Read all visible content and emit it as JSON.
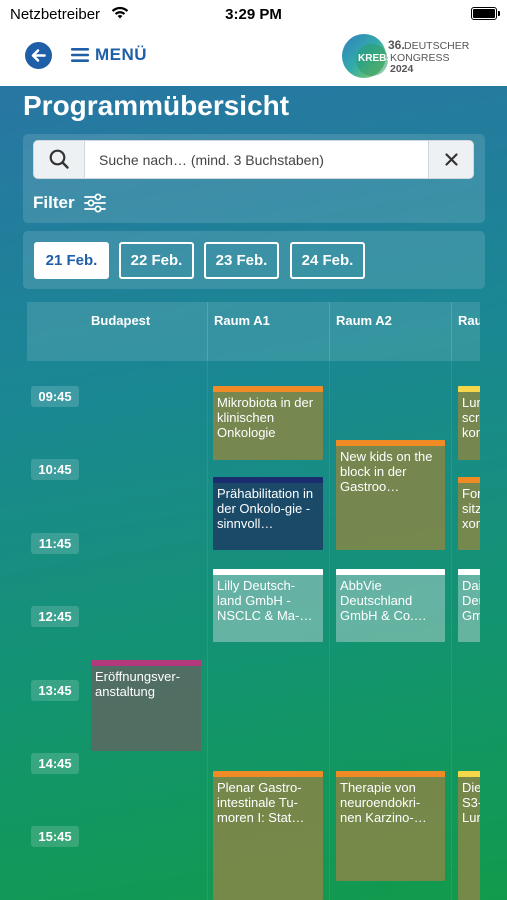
{
  "status_bar": {
    "carrier": "Netzbetreiber",
    "time": "3:29 PM"
  },
  "nav": {
    "menu_label": "MENÜ"
  },
  "logo": {
    "number": "36.",
    "line1": "DEUTSCHER",
    "line2_a": "KREBS",
    "line2_b": "KONGRESS",
    "year": "2024"
  },
  "page": {
    "title": "Programmübersicht"
  },
  "search": {
    "placeholder": "Suche nach… (mind. 3 Buchstaben)",
    "value": ""
  },
  "filter": {
    "label": "Filter"
  },
  "dates": [
    {
      "label": "21 Feb.",
      "active": true
    },
    {
      "label": "22 Feb.",
      "active": false
    },
    {
      "label": "23 Feb.",
      "active": false
    },
    {
      "label": "24 Feb.",
      "active": false
    }
  ],
  "schedule": {
    "rooms": [
      "Budapest",
      "Raum A1",
      "Raum A2",
      "Rau"
    ],
    "times": [
      "09:45",
      "10:45",
      "11:45",
      "12:45",
      "13:45",
      "14:45",
      "15:45"
    ],
    "events": [
      {
        "room": "Raum A1",
        "title": "Mikrobiota in der klinischen Onkologie",
        "color": "orange"
      },
      {
        "room": "Raum A1",
        "title": "Prähabilitation in der Onkolo-gie - sinnvoll…",
        "color": "navy"
      },
      {
        "room": "Raum A1",
        "title": "Lilly Deutsch-land GmbH - NSCLC & Ma-…",
        "color": "white"
      },
      {
        "room": "Raum A1",
        "title": "Plenar Gastro-intestinale Tu-moren I: Stat…",
        "color": "orange"
      },
      {
        "room": "Raum A2",
        "title": "New kids on the block in der Gastroo…",
        "color": "orange"
      },
      {
        "room": "Raum A2",
        "title": "AbbVie Deutschland GmbH & Co.…",
        "color": "white"
      },
      {
        "room": "Raum A2",
        "title": "Therapie von neuroendokri-nen Karzino-…",
        "color": "orange"
      },
      {
        "room": "Budapest",
        "title": "Eröffnungsver-anstaltung",
        "color": "pink"
      },
      {
        "room": "Rau",
        "title": "Lun scre kon",
        "color": "yellow"
      },
      {
        "room": "Rau",
        "title": "For sitz xon",
        "color": "orange"
      },
      {
        "room": "Rau",
        "title": "Dai Deu Gm",
        "color": "white"
      },
      {
        "room": "Rau",
        "title": "Die S3- Lun",
        "color": "yellow"
      }
    ]
  },
  "colors": {
    "primary": "#1f5fa8",
    "gradient_top": "#2876a3",
    "gradient_bottom": "#129a4c"
  }
}
